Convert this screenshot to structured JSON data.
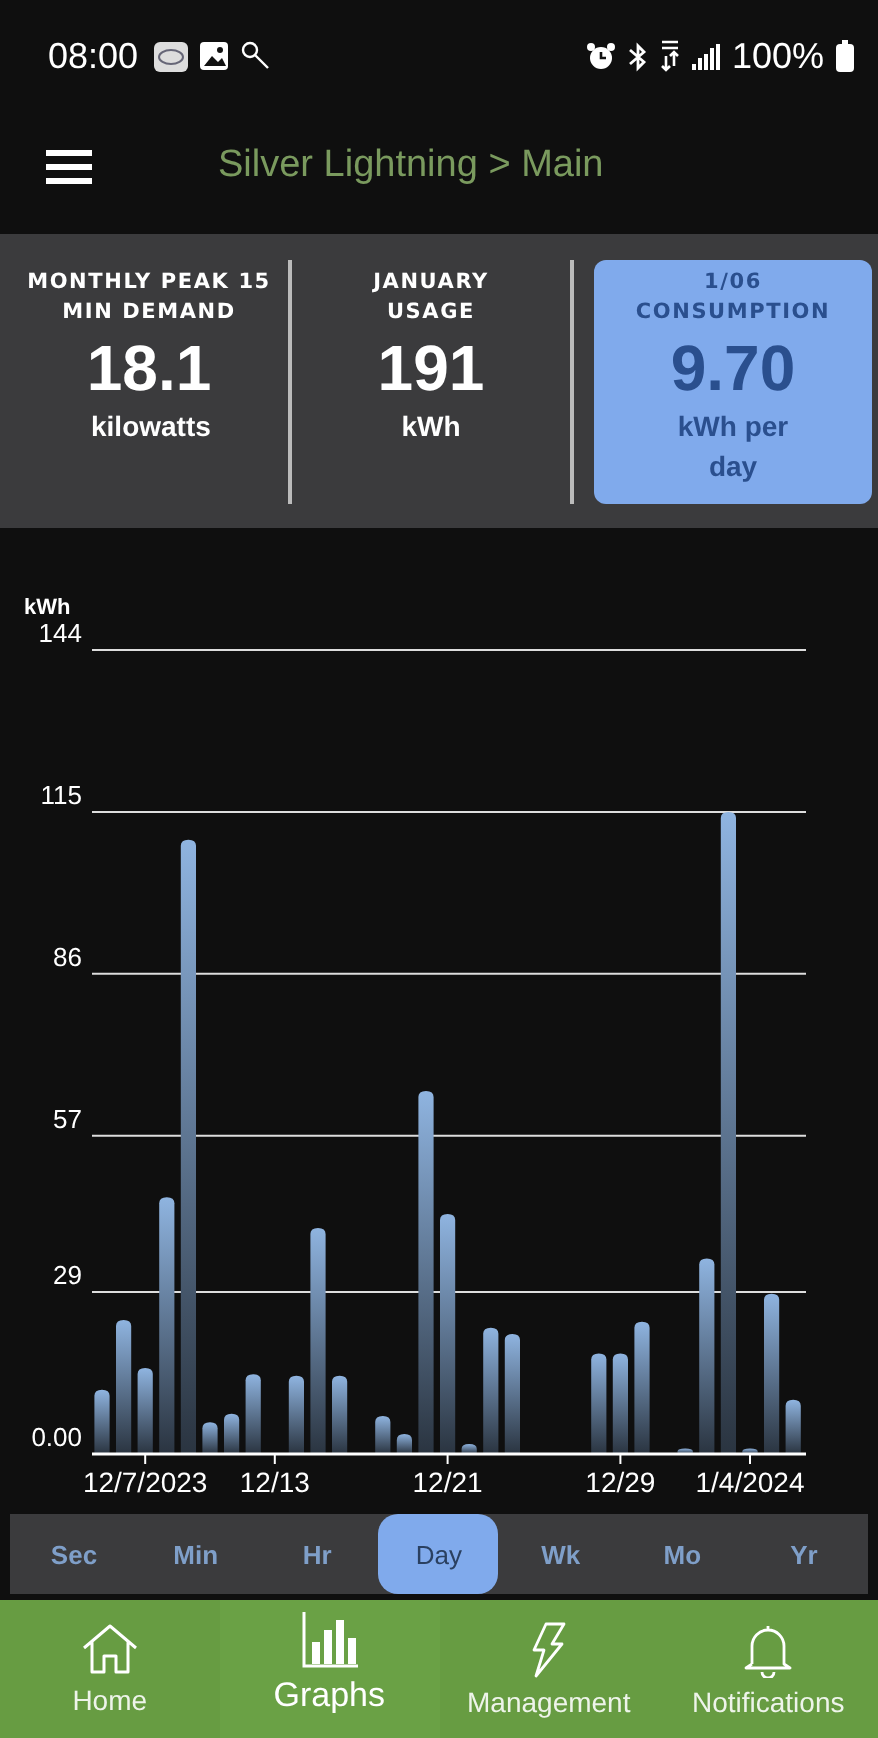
{
  "status_bar": {
    "time": "08:00",
    "battery": "100%"
  },
  "header": {
    "title": "Silver Lightning > Main"
  },
  "stats": [
    {
      "label": "MONTHLY PEAK 15 MIN DEMAND",
      "value": "18.1",
      "unit": "kilowatts",
      "selected": false
    },
    {
      "label": "JANUARY USAGE",
      "value": "191",
      "unit": "kWh",
      "selected": false
    },
    {
      "label": "1/06 CONSUMPTION",
      "value": "9.70",
      "unit": "kWh per day",
      "selected": true
    }
  ],
  "chart": {
    "chart_data": {
      "type": "bar",
      "ylabel": "kWh",
      "grid": true,
      "categories": [
        null,
        null,
        "12/7/2023",
        null,
        null,
        null,
        null,
        null,
        "12/13",
        null,
        null,
        null,
        null,
        null,
        null,
        null,
        "12/21",
        null,
        null,
        null,
        null,
        null,
        null,
        null,
        "12/29",
        null,
        null,
        null,
        null,
        null,
        "1/4/2024",
        null,
        null
      ],
      "values": [
        11.5,
        24,
        15.4,
        46,
        110,
        5.7,
        7.2,
        14.3,
        null,
        14,
        40.5,
        14,
        null,
        6.8,
        3.6,
        65,
        43,
        1.8,
        22.6,
        21.5,
        null,
        null,
        null,
        18,
        18,
        23.7,
        null,
        1,
        35,
        115,
        1,
        28.7,
        9.7
      ],
      "ylim": [
        0,
        144
      ],
      "yticks": [
        {
          "value": 0,
          "label": "0.00"
        },
        29,
        57,
        86,
        115,
        144
      ]
    }
  },
  "ranges": [
    {
      "label": "Sec",
      "selected": false
    },
    {
      "label": "Min",
      "selected": false
    },
    {
      "label": "Hr",
      "selected": false
    },
    {
      "label": "Day",
      "selected": true
    },
    {
      "label": "Wk",
      "selected": false
    },
    {
      "label": "Mo",
      "selected": false
    },
    {
      "label": "Yr",
      "selected": false
    }
  ],
  "nav": [
    {
      "label": "Home",
      "selected": false
    },
    {
      "label": "Graphs",
      "selected": true
    },
    {
      "label": "Management",
      "selected": false
    },
    {
      "label": "Notifications",
      "selected": false
    }
  ]
}
